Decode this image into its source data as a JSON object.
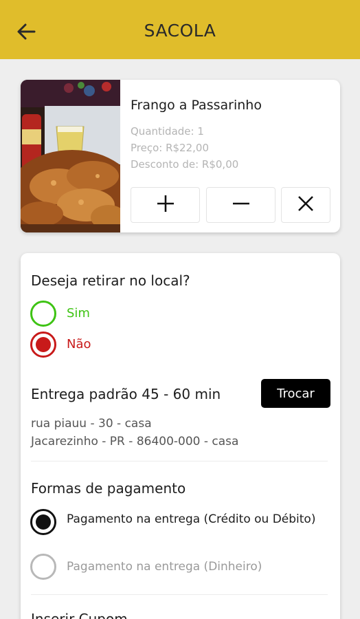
{
  "appbar": {
    "title": "SACOLA",
    "back_icon": "arrow-left-icon",
    "color": "#e0bd2b"
  },
  "product": {
    "name": "Frango a Passarinho",
    "quantity": "Quantidade: 1",
    "price": "Preço: R$22,00",
    "discount": "Desconto de: R$0,00",
    "image_desc": "fried-chicken-photo",
    "buttons": {
      "plus": "plus-icon",
      "minus": "minus-icon",
      "remove": "close-icon"
    }
  },
  "pickup": {
    "question": "Deseja retirar no local?",
    "options": [
      {
        "label": "Sim",
        "selected": false,
        "color": "#3ec314"
      },
      {
        "label": "Não",
        "selected": true,
        "color": "#c81a1a"
      }
    ]
  },
  "delivery": {
    "title": "Entrega padrão 45 - 60 min",
    "change_label": "Trocar",
    "address_line1": "rua piauu - 30 - casa",
    "address_line2": "Jacarezinho - PR - 86400-000 - casa"
  },
  "payment": {
    "title": "Formas de pagamento",
    "options": [
      {
        "label": "Pagamento na entrega (Crédito ou Débito)",
        "selected": true
      },
      {
        "label": "Pagamento na entrega (Dinheiro)",
        "selected": false
      }
    ]
  },
  "coupon": {
    "title": "Inserir Cupom"
  }
}
